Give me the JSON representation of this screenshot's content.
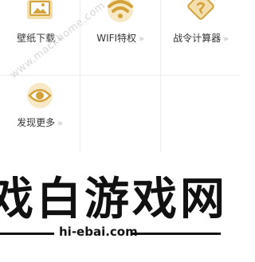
{
  "grid": {
    "items": [
      {
        "label": "壁纸下载",
        "icon": "image-icon"
      },
      {
        "label": "WIFI特权",
        "icon": "wifi-icon"
      },
      {
        "label": "战令计算器",
        "icon": "diamond-badge-icon"
      },
      {
        "label": "发现更多",
        "icon": "eye-icon"
      }
    ],
    "chevron": "»"
  },
  "watermark": "www.mackhome.com",
  "logo": {
    "brand": "戏白游戏网",
    "url": "hi-ebai.com"
  },
  "colors": {
    "accent_gold": "#d4a23a",
    "accent_gold_light": "#f3dfae",
    "divider": "#ececec",
    "text": "#333333"
  }
}
